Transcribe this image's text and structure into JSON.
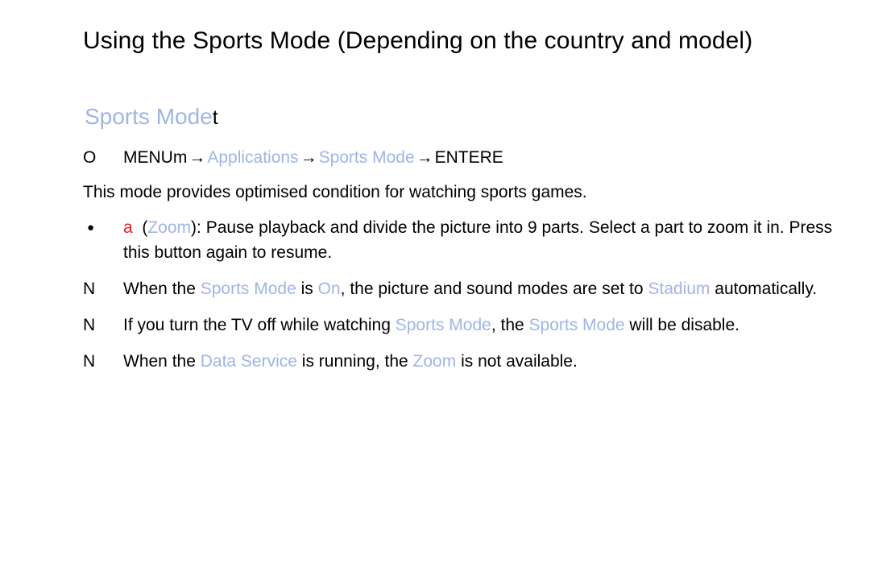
{
  "page": {
    "title": "Using the Sports Mode (Depending on the country and model)",
    "background_color": "#ffffff",
    "text_color": "#000000",
    "ui_term_color": "#9fb5e8",
    "accent_color": "#ee1c24"
  },
  "subheading": {
    "ui_term": "Sports Mode",
    "key_glyph": "t"
  },
  "menu_path": {
    "marker": "O",
    "step_menu": "MENUm",
    "arrow": "→",
    "step_applications": "Applications",
    "step_sports_mode": "Sports Mode",
    "step_enter": "ENTERE"
  },
  "description": {
    "text": "This mode provides optimised condition for watching sports games."
  },
  "bullet": {
    "marker": "●",
    "key_label": "a",
    "open_paren": "(",
    "ui_term": "Zoom",
    "close_paren": ")",
    "text_after": ": Pause playback and divide the picture into 9 parts. Select a part to zoom it in. Press this button again to resume."
  },
  "notes": [
    {
      "marker": "N",
      "part1": "When the ",
      "ui1": "Sports Mode",
      "part2": " is ",
      "ui2": "On",
      "part3": ", the picture and sound modes are set to ",
      "ui3": "Stadium",
      "part4": " automatically."
    },
    {
      "marker": "N",
      "part1": "If you turn the TV off while watching ",
      "ui1": "Sports Mode",
      "part2": ", the ",
      "ui2": "Sports Mode",
      "part3": " will be disable.",
      "ui3": "",
      "part4": ""
    },
    {
      "marker": "N",
      "part1": "When the ",
      "ui1": "Data Service",
      "part2": " is running, the ",
      "ui2": "Zoom",
      "part3": " is not available.",
      "ui3": "",
      "part4": ""
    }
  ]
}
